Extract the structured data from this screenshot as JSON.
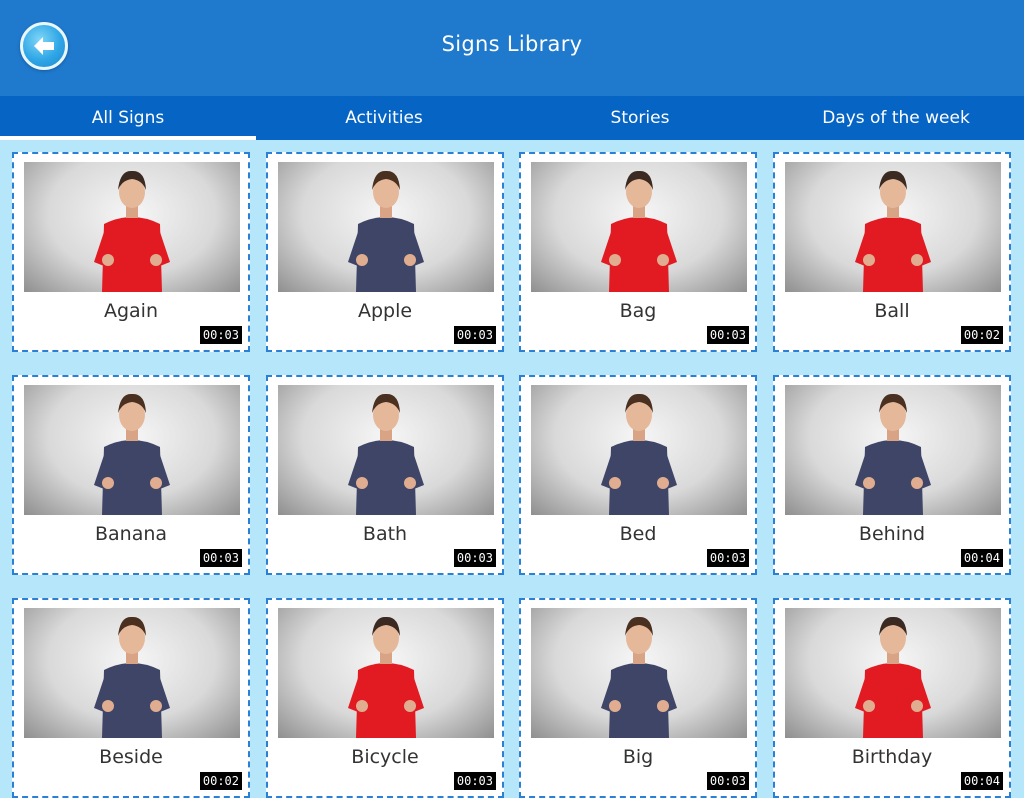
{
  "header": {
    "title": "Signs Library",
    "back_icon": "back-arrow-icon"
  },
  "tabs": [
    {
      "label": "All Signs",
      "active": true
    },
    {
      "label": "Activities",
      "active": false
    },
    {
      "label": "Stories",
      "active": false
    },
    {
      "label": "Days of the week",
      "active": false
    }
  ],
  "signs": [
    {
      "label": "Again",
      "duration": "00:03",
      "presenter": "woman"
    },
    {
      "label": "Apple",
      "duration": "00:03",
      "presenter": "man"
    },
    {
      "label": "Bag",
      "duration": "00:03",
      "presenter": "woman"
    },
    {
      "label": "Ball",
      "duration": "00:02",
      "presenter": "woman"
    },
    {
      "label": "Banana",
      "duration": "00:03",
      "presenter": "man"
    },
    {
      "label": "Bath",
      "duration": "00:03",
      "presenter": "man"
    },
    {
      "label": "Bed",
      "duration": "00:03",
      "presenter": "man"
    },
    {
      "label": "Behind",
      "duration": "00:04",
      "presenter": "man"
    },
    {
      "label": "Beside",
      "duration": "00:02",
      "presenter": "man"
    },
    {
      "label": "Bicycle",
      "duration": "00:03",
      "presenter": "woman"
    },
    {
      "label": "Big",
      "duration": "00:03",
      "presenter": "man"
    },
    {
      "label": "Birthday",
      "duration": "00:04",
      "presenter": "woman"
    }
  ],
  "colors": {
    "header_bg": "#1f79cd",
    "tab_bar_bg": "#0665c4",
    "page_bg": "#b5e6f9",
    "card_border": "#2a7fd6",
    "woman_shirt": "#e21b23",
    "man_shirt": "#3f4566"
  }
}
